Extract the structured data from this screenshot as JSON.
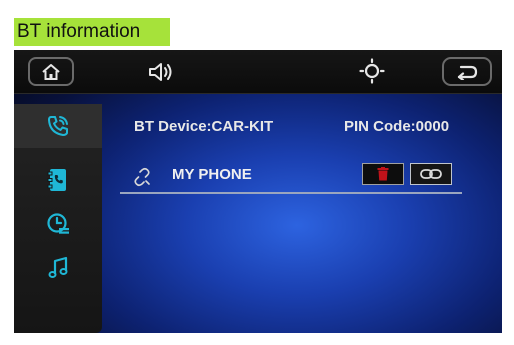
{
  "header_label": "BT information",
  "colors": {
    "label_bg": "#a6e23a",
    "accent": "#1fb7d6",
    "delete": "#c0121a",
    "screen_blue": "#1a3fb0"
  },
  "topbar": {
    "icons": [
      "home-icon",
      "volume-icon",
      "brightness-icon",
      "back-icon"
    ]
  },
  "sidebar": {
    "items": [
      {
        "icon": "phone-call-icon",
        "active": true
      },
      {
        "icon": "contacts-icon",
        "active": false
      },
      {
        "icon": "call-history-icon",
        "active": false
      },
      {
        "icon": "music-icon",
        "active": false
      }
    ]
  },
  "content": {
    "device_text": "BT Device:CAR-KIT",
    "pin_text": "PIN Code:0000",
    "paired_device": {
      "name": "MY PHONE",
      "icon": "unlink-icon",
      "actions": [
        "delete-icon",
        "connect-icon"
      ]
    }
  }
}
